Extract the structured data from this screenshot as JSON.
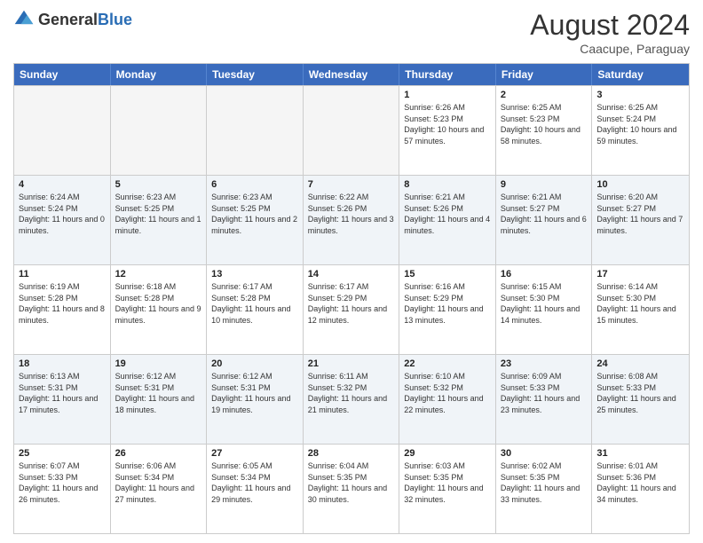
{
  "header": {
    "logo_general": "General",
    "logo_blue": "Blue",
    "month_title": "August 2024",
    "subtitle": "Caacupe, Paraguay"
  },
  "days_of_week": [
    "Sunday",
    "Monday",
    "Tuesday",
    "Wednesday",
    "Thursday",
    "Friday",
    "Saturday"
  ],
  "rows": [
    [
      {
        "day": "",
        "info": "",
        "empty": true
      },
      {
        "day": "",
        "info": "",
        "empty": true
      },
      {
        "day": "",
        "info": "",
        "empty": true
      },
      {
        "day": "",
        "info": "",
        "empty": true
      },
      {
        "day": "1",
        "info": "Sunrise: 6:26 AM\nSunset: 5:23 PM\nDaylight: 10 hours and 57 minutes."
      },
      {
        "day": "2",
        "info": "Sunrise: 6:25 AM\nSunset: 5:23 PM\nDaylight: 10 hours and 58 minutes."
      },
      {
        "day": "3",
        "info": "Sunrise: 6:25 AM\nSunset: 5:24 PM\nDaylight: 10 hours and 59 minutes."
      }
    ],
    [
      {
        "day": "4",
        "info": "Sunrise: 6:24 AM\nSunset: 5:24 PM\nDaylight: 11 hours and 0 minutes."
      },
      {
        "day": "5",
        "info": "Sunrise: 6:23 AM\nSunset: 5:25 PM\nDaylight: 11 hours and 1 minute."
      },
      {
        "day": "6",
        "info": "Sunrise: 6:23 AM\nSunset: 5:25 PM\nDaylight: 11 hours and 2 minutes."
      },
      {
        "day": "7",
        "info": "Sunrise: 6:22 AM\nSunset: 5:26 PM\nDaylight: 11 hours and 3 minutes."
      },
      {
        "day": "8",
        "info": "Sunrise: 6:21 AM\nSunset: 5:26 PM\nDaylight: 11 hours and 4 minutes."
      },
      {
        "day": "9",
        "info": "Sunrise: 6:21 AM\nSunset: 5:27 PM\nDaylight: 11 hours and 6 minutes."
      },
      {
        "day": "10",
        "info": "Sunrise: 6:20 AM\nSunset: 5:27 PM\nDaylight: 11 hours and 7 minutes."
      }
    ],
    [
      {
        "day": "11",
        "info": "Sunrise: 6:19 AM\nSunset: 5:28 PM\nDaylight: 11 hours and 8 minutes."
      },
      {
        "day": "12",
        "info": "Sunrise: 6:18 AM\nSunset: 5:28 PM\nDaylight: 11 hours and 9 minutes."
      },
      {
        "day": "13",
        "info": "Sunrise: 6:17 AM\nSunset: 5:28 PM\nDaylight: 11 hours and 10 minutes."
      },
      {
        "day": "14",
        "info": "Sunrise: 6:17 AM\nSunset: 5:29 PM\nDaylight: 11 hours and 12 minutes."
      },
      {
        "day": "15",
        "info": "Sunrise: 6:16 AM\nSunset: 5:29 PM\nDaylight: 11 hours and 13 minutes."
      },
      {
        "day": "16",
        "info": "Sunrise: 6:15 AM\nSunset: 5:30 PM\nDaylight: 11 hours and 14 minutes."
      },
      {
        "day": "17",
        "info": "Sunrise: 6:14 AM\nSunset: 5:30 PM\nDaylight: 11 hours and 15 minutes."
      }
    ],
    [
      {
        "day": "18",
        "info": "Sunrise: 6:13 AM\nSunset: 5:31 PM\nDaylight: 11 hours and 17 minutes."
      },
      {
        "day": "19",
        "info": "Sunrise: 6:12 AM\nSunset: 5:31 PM\nDaylight: 11 hours and 18 minutes."
      },
      {
        "day": "20",
        "info": "Sunrise: 6:12 AM\nSunset: 5:31 PM\nDaylight: 11 hours and 19 minutes."
      },
      {
        "day": "21",
        "info": "Sunrise: 6:11 AM\nSunset: 5:32 PM\nDaylight: 11 hours and 21 minutes."
      },
      {
        "day": "22",
        "info": "Sunrise: 6:10 AM\nSunset: 5:32 PM\nDaylight: 11 hours and 22 minutes."
      },
      {
        "day": "23",
        "info": "Sunrise: 6:09 AM\nSunset: 5:33 PM\nDaylight: 11 hours and 23 minutes."
      },
      {
        "day": "24",
        "info": "Sunrise: 6:08 AM\nSunset: 5:33 PM\nDaylight: 11 hours and 25 minutes."
      }
    ],
    [
      {
        "day": "25",
        "info": "Sunrise: 6:07 AM\nSunset: 5:33 PM\nDaylight: 11 hours and 26 minutes."
      },
      {
        "day": "26",
        "info": "Sunrise: 6:06 AM\nSunset: 5:34 PM\nDaylight: 11 hours and 27 minutes."
      },
      {
        "day": "27",
        "info": "Sunrise: 6:05 AM\nSunset: 5:34 PM\nDaylight: 11 hours and 29 minutes."
      },
      {
        "day": "28",
        "info": "Sunrise: 6:04 AM\nSunset: 5:35 PM\nDaylight: 11 hours and 30 minutes."
      },
      {
        "day": "29",
        "info": "Sunrise: 6:03 AM\nSunset: 5:35 PM\nDaylight: 11 hours and 32 minutes."
      },
      {
        "day": "30",
        "info": "Sunrise: 6:02 AM\nSunset: 5:35 PM\nDaylight: 11 hours and 33 minutes."
      },
      {
        "day": "31",
        "info": "Sunrise: 6:01 AM\nSunset: 5:36 PM\nDaylight: 11 hours and 34 minutes."
      }
    ]
  ]
}
